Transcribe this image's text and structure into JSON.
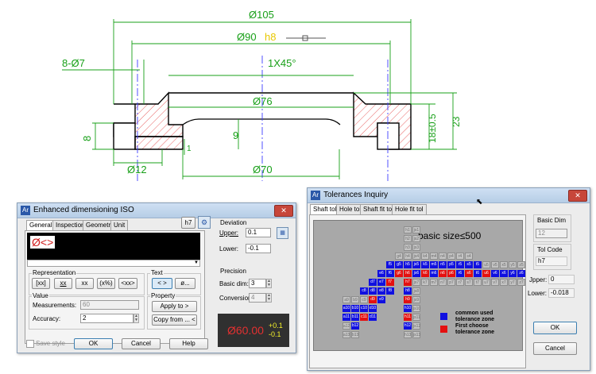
{
  "drawing": {
    "d105": "Ø105",
    "d90": "Ø90",
    "fit_h8": "h8",
    "holes": "8-Ø7",
    "chamfer": "1X45°",
    "d76": "Ø76",
    "d12": "Ø12",
    "d70": "Ø70",
    "h8": "8",
    "h9": "9",
    "h1": "1",
    "tol_18": "18±0.5",
    "h23": "23"
  },
  "colors": {
    "dim_green": "#18a018",
    "hatch_red": "#e23c3c",
    "center_blue": "#3d3dff",
    "common_zone": "#1010e0",
    "first_zone": "#e41010"
  },
  "dim_dialog": {
    "title": "Enhanced dimensioning ISO",
    "h7_button": "h7",
    "tabs": [
      "General",
      "Inspection",
      "Geometry",
      "Unit"
    ],
    "preview_text": "Ø<>",
    "representation_label": "Representation",
    "repr_buttons": [
      "[xx]",
      "xx",
      "xx",
      "(x%)",
      "<xx>"
    ],
    "text_label": "Text",
    "text_buttons": [
      "< >",
      "ø..."
    ],
    "value_label": "Value",
    "measurements_label": "Measurements:",
    "measurements_value": "60",
    "accuracy_label": "Accuracy:",
    "accuracy_value": "2",
    "property_label": "Property",
    "apply_to": "Apply to >",
    "copy_from": "Copy from ... <",
    "deviation_label": "Deviation",
    "upper_label": "Upper:",
    "upper_value": "0.1",
    "lower_label": "Lower:",
    "lower_value": "-0.1",
    "precision_label": "Precision",
    "basic_dim_label": "Basic dim:",
    "basic_dim_value": "3",
    "conversion_label": "Conversion",
    "conversion_value": "4",
    "preview_main": "Ø60.00",
    "preview_upper": "+0.1",
    "preview_lower": "-0.1",
    "save_style": "Save style",
    "ok": "OK",
    "cancel": "Cancel",
    "help": "Help"
  },
  "tol_dialog": {
    "title": "Tolerances Inquiry",
    "tabs": [
      "Shaft tol",
      "Hole tol",
      "Shaft fit tol",
      "Hole fit tol"
    ],
    "basic_size_text": "basic size≤500",
    "legend_common": "common used",
    "legend_common2": "tolerance zone",
    "legend_first": "First choose",
    "legend_first2": "tolerance zone",
    "basic_dim_label": "Basic Dim",
    "basic_dim_value": "12",
    "tol_code_label": "Tol Code",
    "tol_code_value": "h7",
    "upper_label": "Jpper:",
    "upper_value": "0",
    "lower_label": "Lower:",
    "lower_value": "-0.018",
    "ok": "OK",
    "cancel": "Cancel",
    "grid_rows": [
      [
        "h1",
        "js1"
      ],
      [
        "h2",
        "js2"
      ],
      [
        "h3",
        "js3"
      ],
      [
        "g4",
        "h4",
        "js4",
        "k4",
        "m4",
        "n4",
        "p4",
        "r4",
        "s4"
      ],
      [
        "f5",
        "g5",
        "h5",
        "js5",
        "k5",
        "m5",
        "n5",
        "p5",
        "r5",
        "s5",
        "t5",
        "u5",
        "v5",
        "x5",
        "y5",
        "z5"
      ],
      [
        "e6",
        "f6",
        "g6",
        "h6",
        "js6",
        "k6",
        "m6",
        "n6",
        "p6",
        "r6",
        "s6",
        "t6",
        "u6",
        "v6",
        "x6",
        "y6",
        "z6"
      ],
      [
        "d7",
        "e7",
        "f7",
        "h7",
        "js7",
        "k7",
        "m7",
        "n7",
        "p7",
        "r7",
        "s7",
        "t7",
        "u7",
        "v7",
        "x7",
        "y7",
        "z7"
      ],
      [
        "c8",
        "d8",
        "e8",
        "f8",
        "h8",
        "js8"
      ],
      [
        "a9",
        "b9",
        "c9",
        "d9",
        "e9",
        "h9",
        "js9"
      ],
      [
        "a10",
        "b10",
        "c10",
        "d10",
        "h10",
        "js10"
      ],
      [
        "a11",
        "b11",
        "c11",
        "d11",
        "h11",
        "js11"
      ],
      [
        "a12",
        "b12",
        "h12",
        "js12"
      ],
      [
        "a13",
        "b13",
        "h13",
        "js13"
      ]
    ]
  }
}
